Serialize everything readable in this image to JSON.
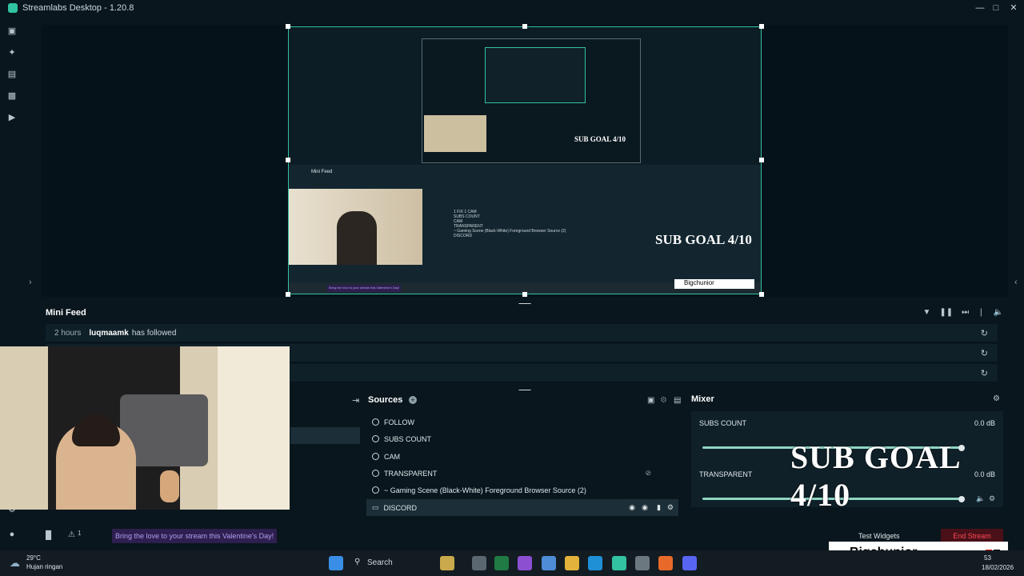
{
  "window": {
    "title": "Streamlabs Desktop - 1.20.8"
  },
  "preview": {
    "inner_feed_title": "Mini Feed",
    "inner_sources": [
      "1 FIX 1 CAM",
      "SUBS COUNT",
      "CAM",
      "TRANSPARENT",
      "~ Gaming Scene (Black-White) Foreground Browser Source (2)",
      "DISCORD"
    ],
    "inner_goal": "SUB GOAL 4/10",
    "inner_tiktok": "Bigchunior",
    "inner_banner": "Bring the love to your stream this Valentine's Day!"
  },
  "minifeed": {
    "title": "Mini Feed",
    "rows": [
      {
        "time": "2 hours",
        "user": "luqmaamk",
        "action": "has followed"
      },
      {
        "time": "",
        "user": "",
        "action": ""
      },
      {
        "time": "",
        "user": "",
        "action": ""
      }
    ]
  },
  "sources": {
    "title": "Sources",
    "items": [
      {
        "label": "FOLLOW"
      },
      {
        "label": "SUBS COUNT"
      },
      {
        "label": "CAM"
      },
      {
        "label": "TRANSPARENT"
      },
      {
        "label": "~ Gaming Scene (Black-White) Foreground Browser Source (2)"
      },
      {
        "label": "DISCORD"
      }
    ]
  },
  "mixer": {
    "title": "Mixer",
    "channels": [
      {
        "name": "SUBS COUNT",
        "db": "0.0 dB"
      },
      {
        "name": "TRANSPARENT",
        "db": "0.0 dB"
      }
    ]
  },
  "overlay": {
    "goal": "SUB GOAL 4/10",
    "tiktok_name": "Bigchunior"
  },
  "footer": {
    "notif_count": "1",
    "banner": "Bring the love to your stream this Valentine's Day!",
    "test_widgets": "Test Widgets",
    "end_stream": "End Stream"
  },
  "taskbar": {
    "weather_temp": "29°C",
    "weather_desc": "Hujan ringan",
    "search": "Search",
    "time": "53",
    "date": "18/02/2026"
  },
  "colors": {
    "accent": "#31c3a2",
    "bg": "#09161d",
    "end_stream": "#ff4a57"
  }
}
